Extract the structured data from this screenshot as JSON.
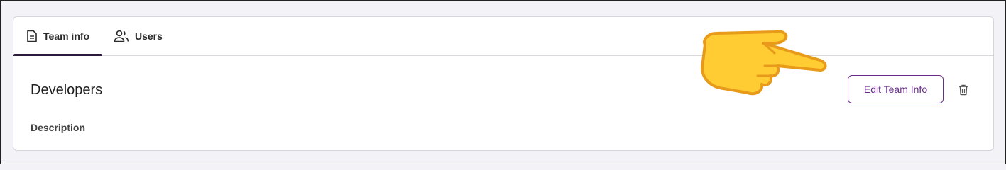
{
  "tabs": [
    {
      "label": "Team info",
      "icon": "document-icon",
      "active": true
    },
    {
      "label": "Users",
      "icon": "users-icon",
      "active": false
    }
  ],
  "team": {
    "name": "Developers",
    "description_label": "Description"
  },
  "actions": {
    "edit_label": "Edit Team Info",
    "delete_icon": "trash-icon"
  },
  "colors": {
    "accent": "#6b2d8c",
    "active_tab_underline": "#2d1a3f",
    "hand": "#ffcc33"
  }
}
